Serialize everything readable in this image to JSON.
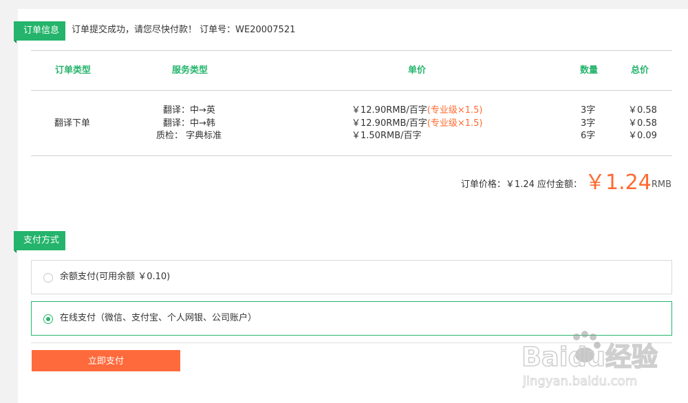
{
  "order_section": {
    "tag": "订单信息",
    "message": "订单提交成功，请您尽快付款！ 订单号：WE20007521"
  },
  "table": {
    "headers": {
      "order_type": "订单类型",
      "service_type": "服务类型",
      "unit_price": "单价",
      "quantity": "数量",
      "total": "总价"
    },
    "order_type": "翻译下单",
    "rows": [
      {
        "service": "翻译：中→英",
        "price": "￥12.90RMB/百字",
        "level": "(专业级×1.5)",
        "quantity": "3字",
        "total": "￥0.58"
      },
      {
        "service": "翻译：中→韩",
        "price": "￥12.90RMB/百字",
        "level": "(专业级×1.5)",
        "quantity": "3字",
        "total": "￥0.58"
      },
      {
        "service": "质检： 字典标准",
        "price": "￥1.50RMB/百字",
        "level": "",
        "quantity": "6字",
        "total": "￥0.09"
      }
    ]
  },
  "summary": {
    "order_price_label": "订单价格：￥1.24",
    "due_label": "应付金额：",
    "due_amount": "￥1.24",
    "unit": "RMB"
  },
  "payment_section": {
    "tag": "支付方式",
    "options": [
      {
        "label": "余额支付(可用余额 ￥0.10)",
        "selected": false
      },
      {
        "label": "在线支付（微信、支付宝、个人网银、公司账户）",
        "selected": true
      }
    ],
    "pay_button": "立即支付"
  },
  "watermark": {
    "brand": "Baidu经验",
    "url": "jingyan.baidu.com"
  },
  "colors": {
    "accent_green": "#24b46b",
    "accent_orange": "#ff6a2f"
  }
}
